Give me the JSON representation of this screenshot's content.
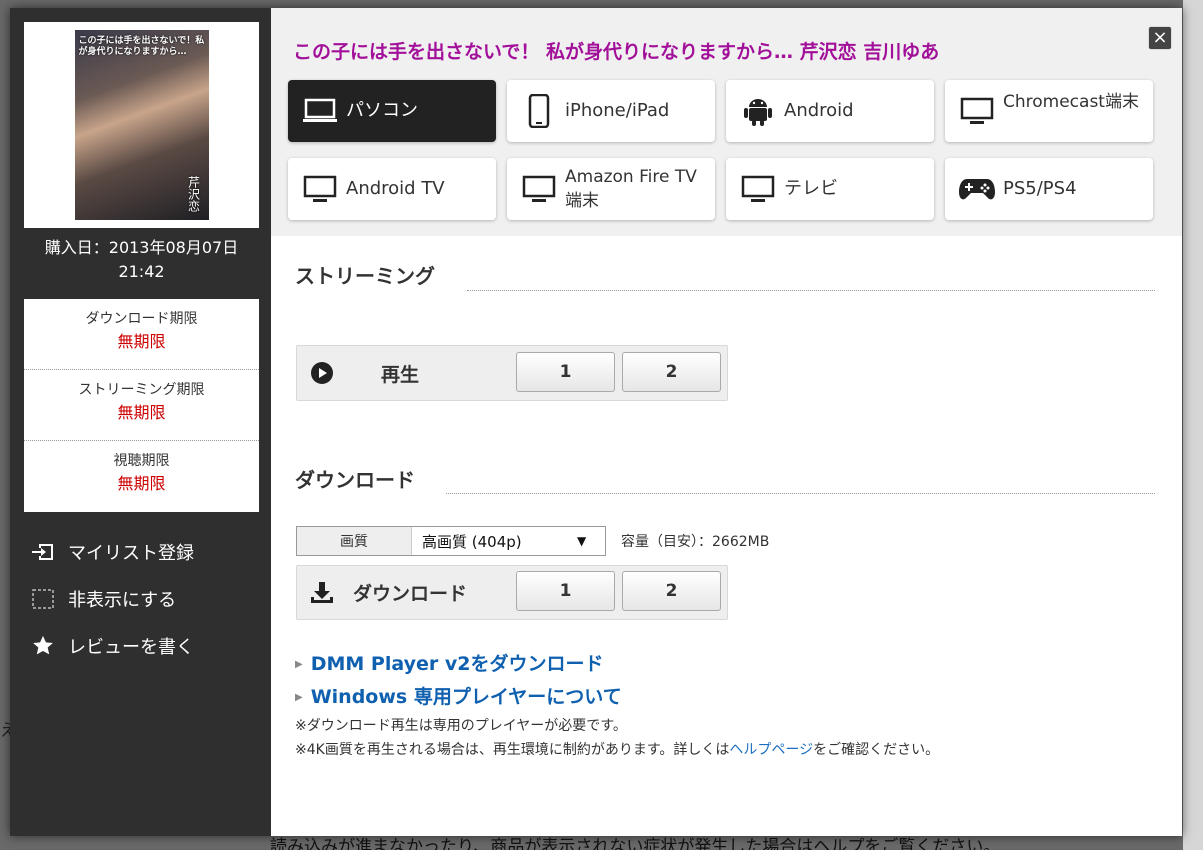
{
  "background": {
    "bottom_text": "読み込みが進まなかったり、商品が表示されない症状が発生した場合はヘルプをご覧ください。",
    "left_text": "える"
  },
  "sidebar": {
    "cover": {
      "title_text": "この子には手を出さないで！私が身代りになりますから…",
      "name_text": "芹沢恋"
    },
    "purchase_date": "購入日：2013年08月07日",
    "purchase_time": "21:42",
    "limits": [
      {
        "label": "ダウンロード期限",
        "value": "無期限"
      },
      {
        "label": "ストリーミング期限",
        "value": "無期限"
      },
      {
        "label": "視聴期限",
        "value": "無期限"
      }
    ],
    "menu": [
      {
        "label": "マイリスト登録",
        "icon": "mylist-add-icon"
      },
      {
        "label": "非表示にする",
        "icon": "hide-icon"
      },
      {
        "label": "レビューを書く",
        "icon": "star-icon"
      }
    ]
  },
  "content": {
    "title": "この子には手を出さないで！ 私が身代りになりますから… 芹沢恋 吉川ゆあ",
    "close_label": "×",
    "devices": [
      {
        "label": "パソコン",
        "icon": "laptop-icon",
        "active": true
      },
      {
        "label": "iPhone/iPad",
        "icon": "smartphone-icon"
      },
      {
        "label": "Android",
        "icon": "android-icon"
      },
      {
        "label": "Chromecast端末",
        "icon": "monitor-icon"
      },
      {
        "label": "Android TV",
        "icon": "monitor-icon"
      },
      {
        "label": "Amazon Fire TV 端末",
        "icon": "monitor-icon"
      },
      {
        "label": "テレビ",
        "icon": "monitor-icon"
      },
      {
        "label": "PS5/PS4",
        "icon": "gamepad-icon"
      }
    ],
    "streaming": {
      "heading": "ストリーミング",
      "play_label": "再生",
      "buttons": [
        "1",
        "2"
      ]
    },
    "download": {
      "heading": "ダウンロード",
      "quality_label": "画質",
      "quality_value": "高画質 (404p)",
      "capacity": "容量（目安）：2662MB",
      "download_label": "ダウンロード",
      "buttons": [
        "1",
        "2"
      ]
    },
    "links": [
      {
        "label": "DMM Player v2をダウンロード"
      },
      {
        "label": "Windows 専用プレイヤーについて"
      }
    ],
    "notes": {
      "line1": "※ダウンロード再生は専用のプレイヤーが必要です。",
      "line2_pre": "※4K画質を再生される場合は、再生環境に制約があります。詳しくは",
      "line2_link": "ヘルプページ",
      "line2_post": "をご確認ください。"
    }
  },
  "colors": {
    "title": "#a2109a",
    "limit_value": "#cc0000",
    "link": "#1060b0",
    "active_device": "#222222"
  }
}
